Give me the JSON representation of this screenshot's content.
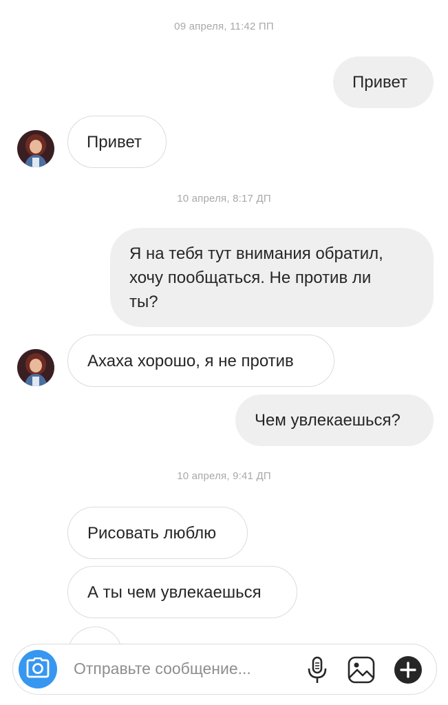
{
  "conversation": {
    "messages": [
      {
        "kind": "timestamp",
        "text": "09 апреля, 11:42 ПП"
      },
      {
        "kind": "outgoing",
        "text": "Привет"
      },
      {
        "kind": "incoming",
        "text": "Привет"
      },
      {
        "kind": "timestamp",
        "text": "10 апреля, 8:17 ДП"
      },
      {
        "kind": "outgoing",
        "lines": [
          "Я на тебя тут внимания обратил,",
          "хочу пообщаться. Не против ли",
          "ты?"
        ]
      },
      {
        "kind": "incoming",
        "text": "Ахаха хорошо, я не против"
      },
      {
        "kind": "outgoing",
        "text": "Чем увлекаешься?"
      },
      {
        "kind": "timestamp",
        "text": "10 апреля, 9:41 ДП"
      },
      {
        "kind": "incoming",
        "text": "Рисовать люблю"
      },
      {
        "kind": "incoming",
        "text": "А ты чем увлекаешься"
      }
    ]
  },
  "composer": {
    "placeholder": "Отправьте сообщение...",
    "icons": [
      "camera-icon",
      "microphone-icon",
      "gallery-icon",
      "plus-icon"
    ],
    "accent": "#3797f0"
  }
}
